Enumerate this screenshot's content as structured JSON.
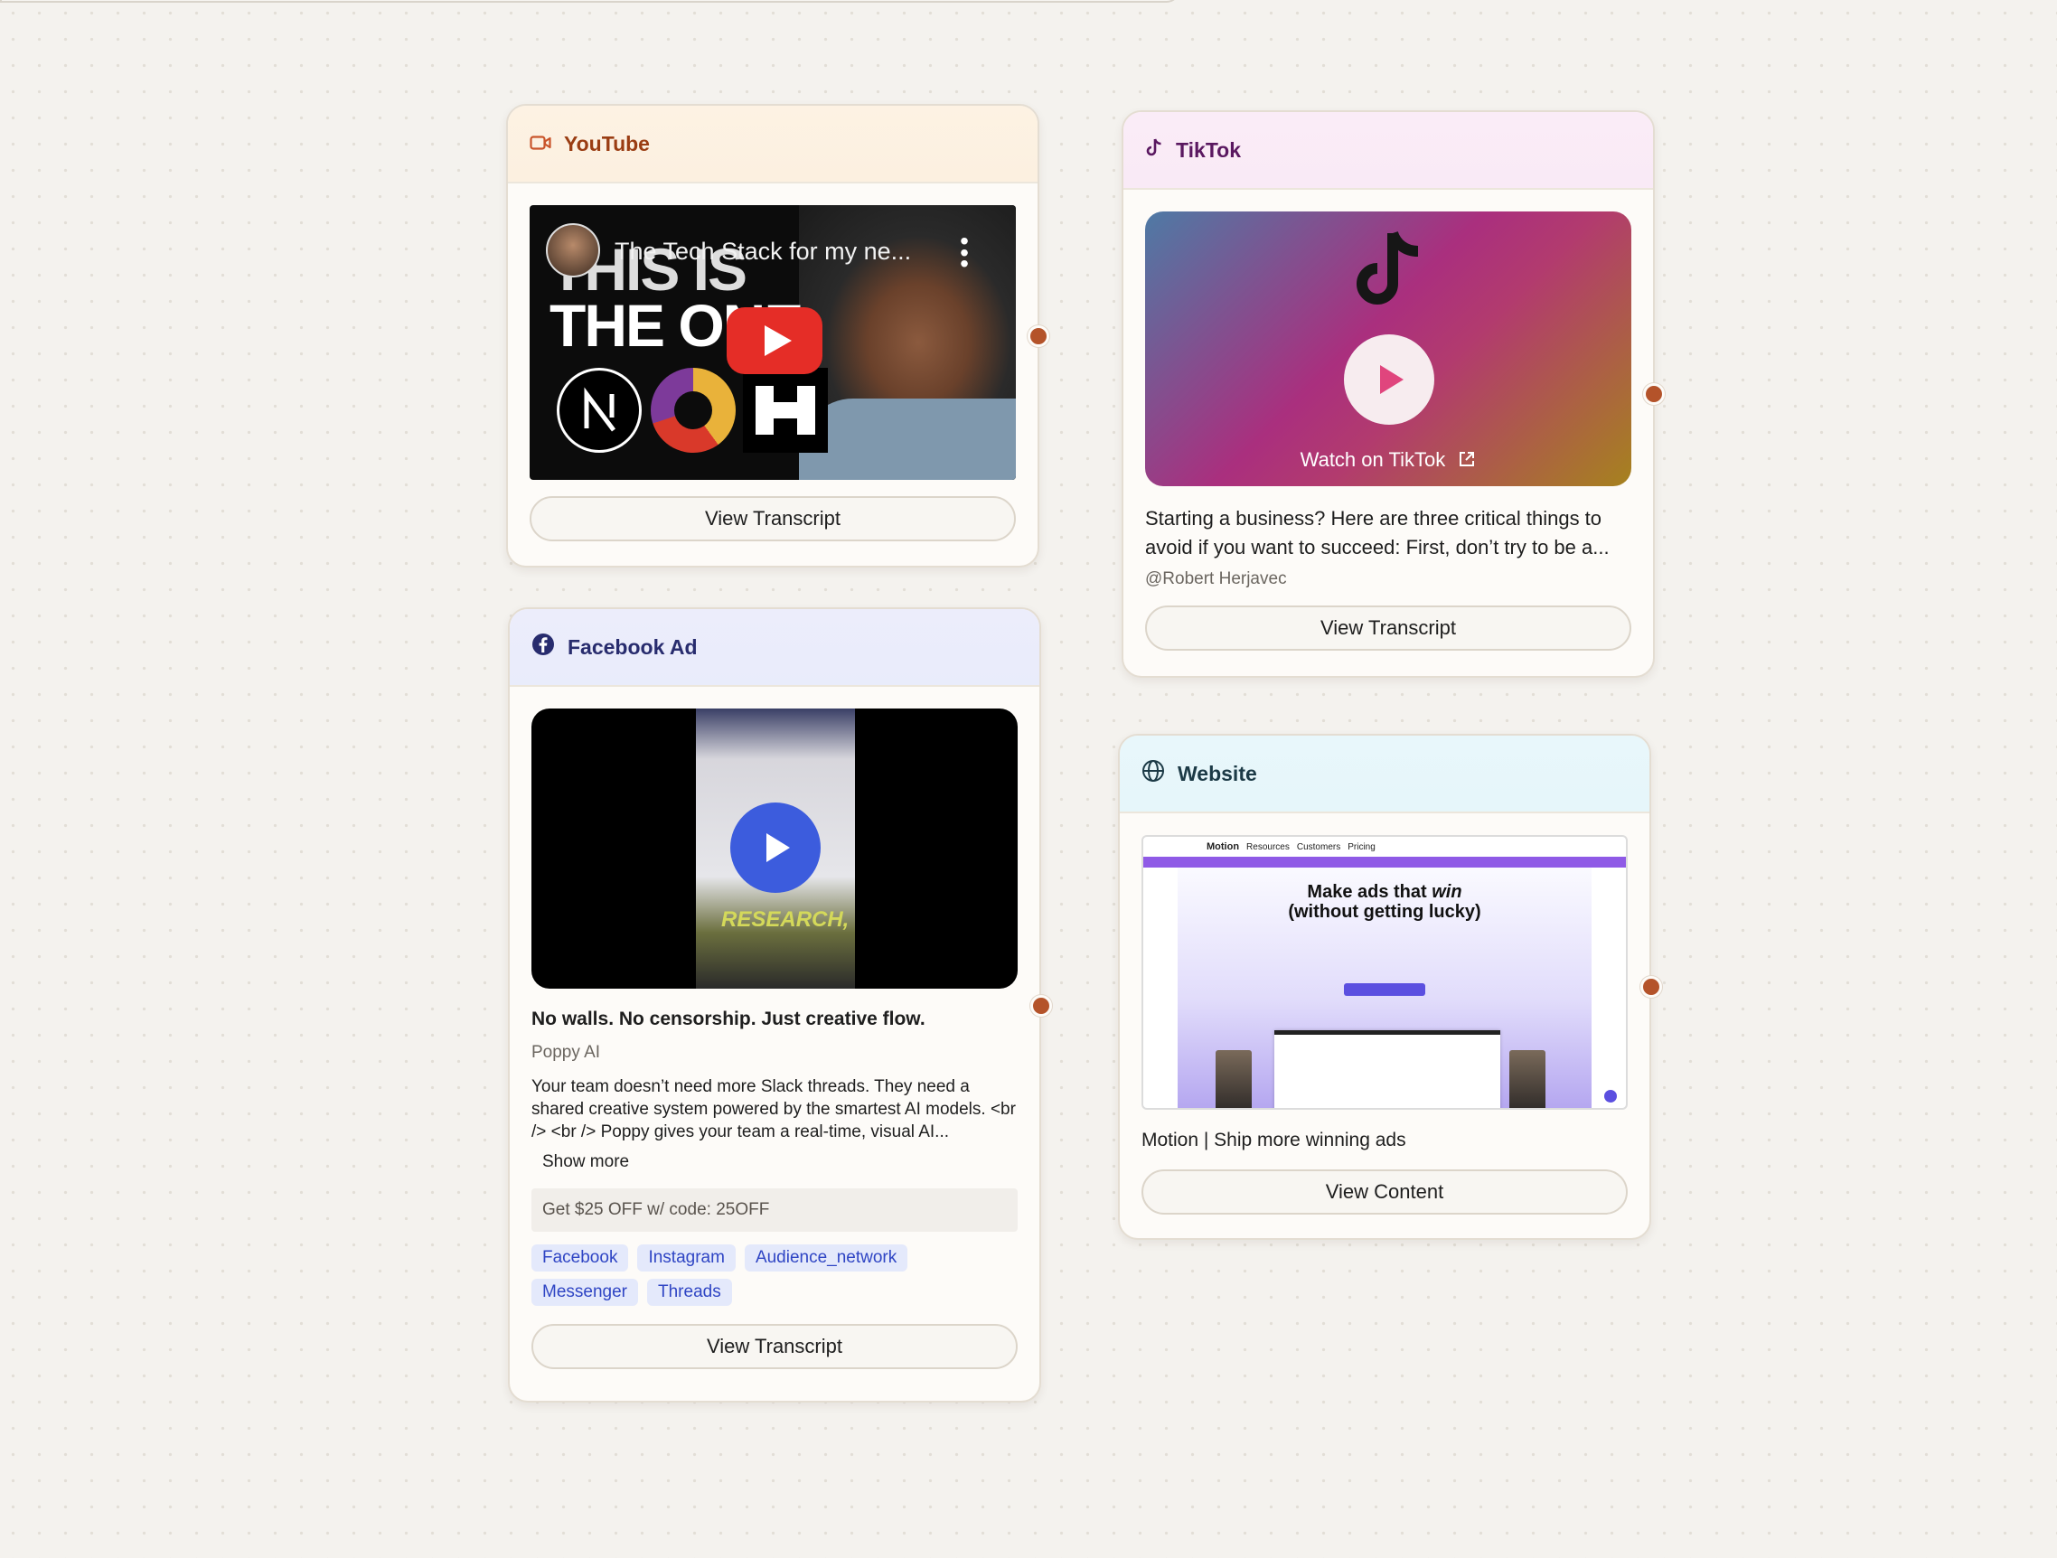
{
  "youtube": {
    "label": "YouTube",
    "thumbnail_big_text_1": "THIS IS",
    "thumbnail_big_text_2": "THE ONE",
    "video_title": "The Tech Stack for my ne...",
    "button": "View Transcript"
  },
  "tiktok": {
    "label": "TikTok",
    "watch_label": "Watch on TikTok",
    "description": "Starting a business? Here are three critical things to avoid if you want to succeed: First, don’t try to be a...",
    "author": "@Robert Herjavec",
    "button": "View Transcript"
  },
  "facebook": {
    "label": "Facebook Ad",
    "video_overlay_text": "RESEARCH,",
    "title": "No walls. No censorship. Just creative flow.",
    "page_name": "Poppy AI",
    "description": "Your team doesn’t need more Slack threads. They need a shared creative system powered by the smartest AI models. <br /> <br /> Poppy gives your team a real-time, visual AI...",
    "show_more": "Show more",
    "offer": "Get $25 OFF w/ code: 25OFF",
    "platforms": [
      "Facebook",
      "Instagram",
      "Audience_network",
      "Messenger",
      "Threads"
    ],
    "button": "View Transcript"
  },
  "website": {
    "label": "Website",
    "preview": {
      "brand": "Motion",
      "nav": [
        "Resources",
        "Customers",
        "Pricing"
      ],
      "headline_1": "Make ads that",
      "headline_win": "win",
      "headline_2": "(without getting lucky)"
    },
    "title": "Motion | Ship more winning ads",
    "button": "View Content"
  },
  "colors": {
    "handle": "#b4532a",
    "youtube_accent": "#9a3d13",
    "tiktok_accent": "#5a1860",
    "facebook_accent": "#282c6e",
    "website_accent": "#1c3a46",
    "tag_text": "#2f45c4"
  },
  "icons": {
    "youtube": "video-camera-icon",
    "tiktok": "tiktok-note-icon",
    "facebook": "facebook-icon",
    "website": "globe-icon"
  }
}
